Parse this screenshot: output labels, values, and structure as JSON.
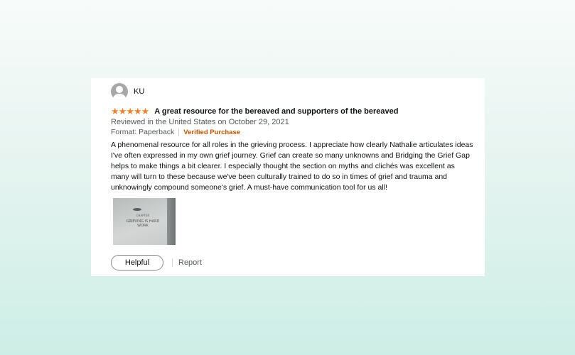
{
  "review": {
    "reviewer_name": "KU",
    "rating": 5,
    "stars": [
      "★",
      "★",
      "★",
      "★",
      "★"
    ],
    "title": "A great resource for the bereaved and supporters of the bereaved",
    "reviewed_meta": "Reviewed in the United States on October 29, 2021",
    "format": "Format: Paperback",
    "verified_label": "Verified Purchase",
    "body_lines": [
      "A phenomenal resource for all roles in the grieving process. I appreciate how clearly Nathalie articulates ideas",
      "I've often expressed in my own grief journey. Grief can create so many unknowns and Bridging the Grief Gap",
      "helps to make things a bit clearer. I especially thought the section on myths and clichés was excellent as",
      "many will turn to these because we've been culturally trained to do so in times of grief and trauma and",
      "unknowingly compound someone's grief. A must-have communication tool for us all!"
    ],
    "image_text": "GRIEVING IS HARD WORK",
    "image_subtext": "CHAPTER"
  },
  "actions": {
    "helpful_label": "Helpful",
    "report_label": "Report"
  },
  "colors": {
    "star": "#f0812b",
    "verified": "#c45500",
    "muted": "#565959"
  }
}
